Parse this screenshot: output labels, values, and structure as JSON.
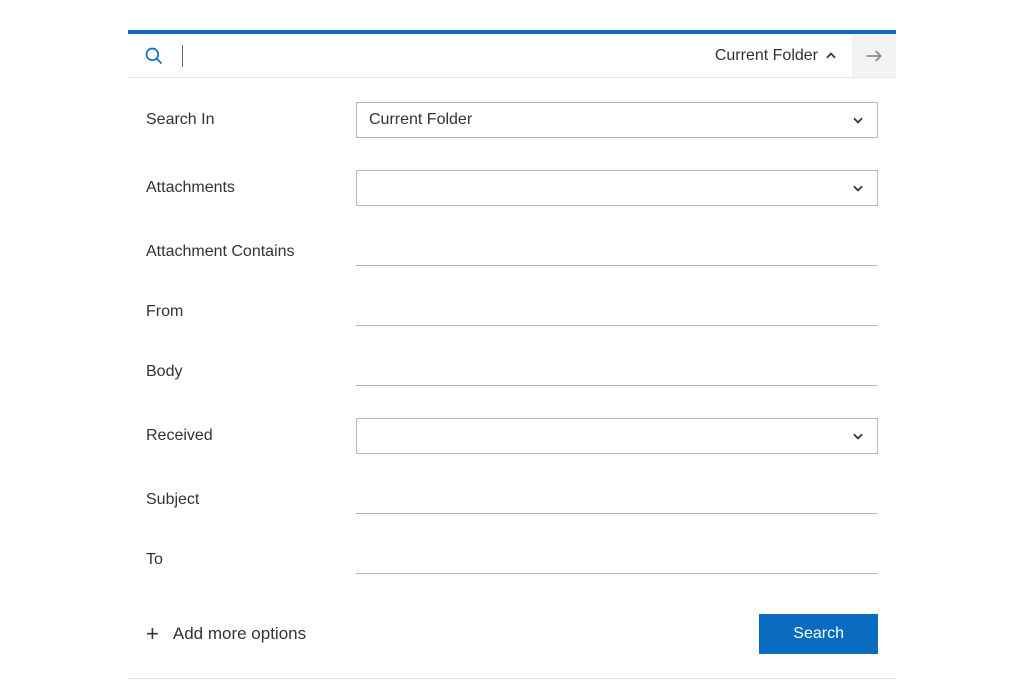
{
  "searchBar": {
    "scopeLabel": "Current Folder",
    "inputValue": ""
  },
  "fields": {
    "searchIn": {
      "label": "Search In",
      "value": "Current Folder"
    },
    "attachments": {
      "label": "Attachments",
      "value": ""
    },
    "attachmentContains": {
      "label": "Attachment Contains",
      "value": ""
    },
    "from": {
      "label": "From",
      "value": ""
    },
    "body": {
      "label": "Body",
      "value": ""
    },
    "received": {
      "label": "Received",
      "value": ""
    },
    "subject": {
      "label": "Subject",
      "value": ""
    },
    "to": {
      "label": "To",
      "value": ""
    }
  },
  "actions": {
    "addMore": "Add more options",
    "search": "Search"
  }
}
